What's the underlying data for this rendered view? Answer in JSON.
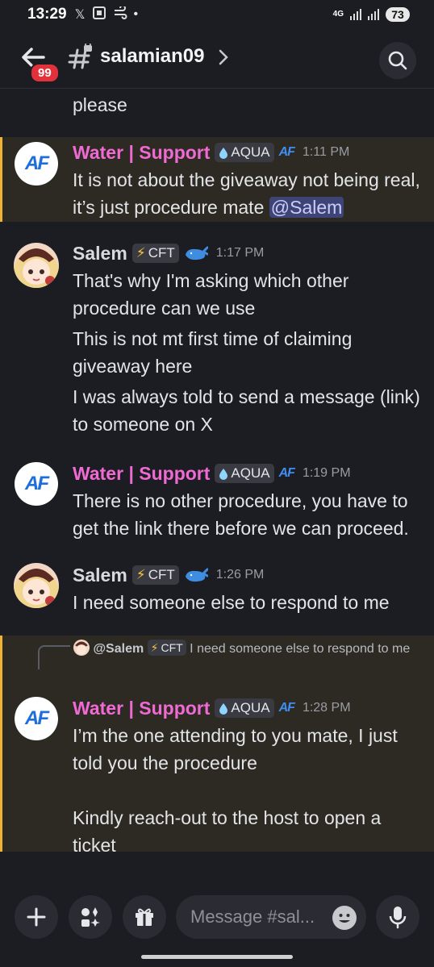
{
  "status_bar": {
    "time": "13:29",
    "network": "4G",
    "battery": "73"
  },
  "header": {
    "unread_badge": "99",
    "channel_name": "salamian09"
  },
  "messages": {
    "m0": {
      "text": "please"
    },
    "m1": {
      "author": "Water | Support",
      "tag": "AQUA",
      "server_mark": "AF",
      "time": "1:11 PM",
      "text": "It is not about the giveaway not being real, it’s just procedure mate ",
      "mention": "@Salem"
    },
    "m2": {
      "author": "Salem",
      "tag": "CFT",
      "time": "1:17 PM",
      "lines": [
        "That's why I'm asking which other procedure can we use",
        "This is not mt first time of claiming giveaway here",
        "I was always told to send a message (link) to someone on X"
      ]
    },
    "m3": {
      "author": "Water | Support",
      "tag": "AQUA",
      "server_mark": "AF",
      "time": "1:19 PM",
      "text": "There is no other procedure, you have to get the link there before we can proceed."
    },
    "m4": {
      "author": "Salem",
      "tag": "CFT",
      "time": "1:26 PM",
      "text": "I need someone else to respond to me"
    },
    "m5": {
      "reply_author": "@Salem",
      "reply_tag": "CFT",
      "reply_text": "I need someone else to respond to me",
      "author": "Water | Support",
      "tag": "AQUA",
      "server_mark": "AF",
      "time": "1:28 PM",
      "line1": "I’m the one attending to you mate, I just told you the procedure",
      "line2": "Kindly reach-out to the host to open a ticket"
    }
  },
  "avatars": {
    "support_logo": "AF"
  },
  "composer": {
    "placeholder": "Message #sal..."
  },
  "icons": [
    "x-icon",
    "screenshot-icon",
    "wind-icon",
    "back-arrow-icon",
    "hash-lock-icon",
    "chevron-right-icon",
    "search-icon",
    "plus-icon",
    "apps-icon",
    "gift-icon",
    "emoji-icon",
    "mic-icon",
    "lightning-icon",
    "water-drop-icon",
    "whale-icon"
  ],
  "colors": {
    "support_name": "#f06ad3",
    "highlight_bar": "#f0b232",
    "mention_bg": "#3f4476",
    "background": "#1c1d22"
  }
}
